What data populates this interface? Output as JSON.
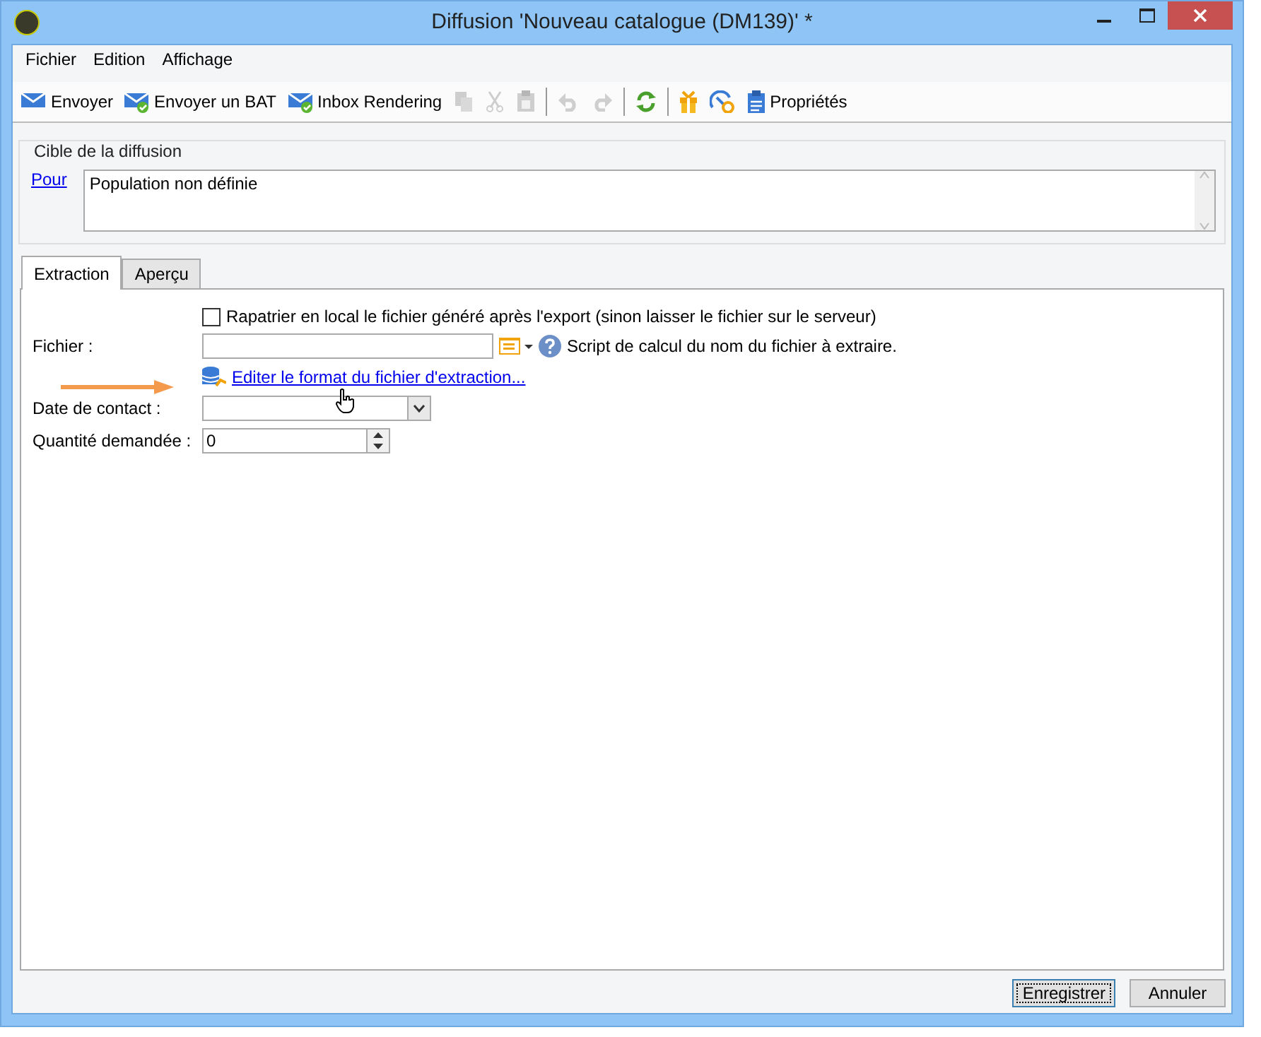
{
  "window": {
    "title": "Diffusion 'Nouveau catalogue (DM139)' *"
  },
  "menu": [
    "Fichier",
    "Edition",
    "Affichage"
  ],
  "toolbar": [
    {
      "kind": "button",
      "label": "Envoyer",
      "disabled": false
    },
    {
      "kind": "button",
      "label": "Envoyer un BAT",
      "disabled": false
    },
    {
      "kind": "button",
      "label": "Inbox Rendering",
      "disabled": false
    },
    {
      "kind": "icon",
      "disabled": true
    },
    {
      "kind": "icon",
      "disabled": true
    },
    {
      "kind": "icon",
      "disabled": true
    },
    {
      "kind": "separator"
    },
    {
      "kind": "icon",
      "disabled": true
    },
    {
      "kind": "icon",
      "disabled": true
    },
    {
      "kind": "separator"
    },
    {
      "kind": "icon",
      "disabled": false
    },
    {
      "kind": "separator"
    },
    {
      "kind": "icon",
      "disabled": false
    },
    {
      "kind": "icon",
      "disabled": false
    },
    {
      "kind": "button",
      "label": "Propriétés",
      "disabled": false
    }
  ],
  "target": {
    "legend": "Cible de la diffusion",
    "link": "Pour",
    "value": "Population non définie"
  },
  "tabs": [
    {
      "label": "Extraction",
      "selected": true
    },
    {
      "label": "Aperçu",
      "selected": false
    }
  ],
  "extraction": {
    "checkbox": {
      "label": "Rapatrier en local le fichier généré après l'export (sinon laisser le fichier sur le serveur)",
      "checked": false
    },
    "file_label": "Fichier :",
    "file_hint": "Script de calcul du nom du fichier à extraire.",
    "edit_link": "Editer le format du fichier d'extraction...",
    "date_label": "Date de contact :",
    "quantity_label": "Quantité demandée :",
    "quantity_value": "0"
  },
  "buttons": [
    {
      "label": "Enregistrer",
      "selected": true
    },
    {
      "label": "Annuler",
      "selected": false
    }
  ]
}
